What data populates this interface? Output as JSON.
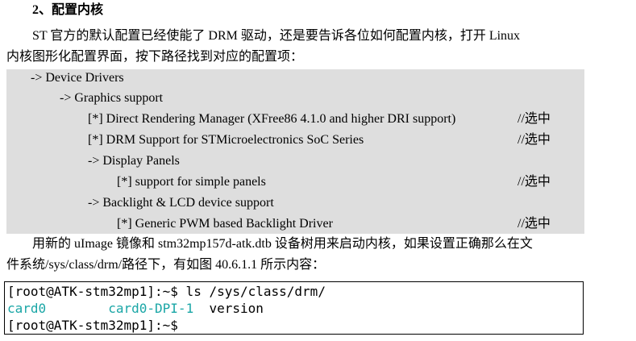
{
  "heading": "2、配置内核",
  "intro": {
    "line1": "ST 官方的默认配置已经使能了 DRM 驱动，还是要告诉各位如何配置内核，打开  Linux",
    "line2": "内核图形化配置界面，按下路径找到对应的配置项："
  },
  "config_path": [
    {
      "text": "-> Device Drivers",
      "note": ""
    },
    {
      "text": "-> Graphics support",
      "note": ""
    },
    {
      "text": "[*] Direct Rendering Manager (XFree86 4.1.0 and higher DRI support)",
      "note": "//选中"
    },
    {
      "text": "[*] DRM Support for STMicroelectronics SoC Series",
      "note": "//选中"
    },
    {
      "text": "-> Display Panels",
      "note": ""
    },
    {
      "text": "[*] support for simple panels",
      "note": "//选中"
    },
    {
      "text": "-> Backlight & LCD device support",
      "note": ""
    },
    {
      "text": "[*] Generic PWM based Backlight Driver",
      "note": "//选中"
    }
  ],
  "after": {
    "line1": "用新的 uImage 镜像和 stm32mp157d-atk.dtb 设备树用来启动内核，如果设置正确那么在文",
    "line2": "件系统/sys/class/drm/路径下，有如图 40.6.1.1 所示内容："
  },
  "terminal": {
    "prompt1": "[root@ATK-stm32mp1]:~$ ls /sys/class/drm/",
    "entry1": "card0",
    "entry2": "card0-DPI-1",
    "entry3": "version",
    "prompt2": "[root@ATK-stm32mp1]:~$",
    "entry_color": "#1aa6a6"
  }
}
